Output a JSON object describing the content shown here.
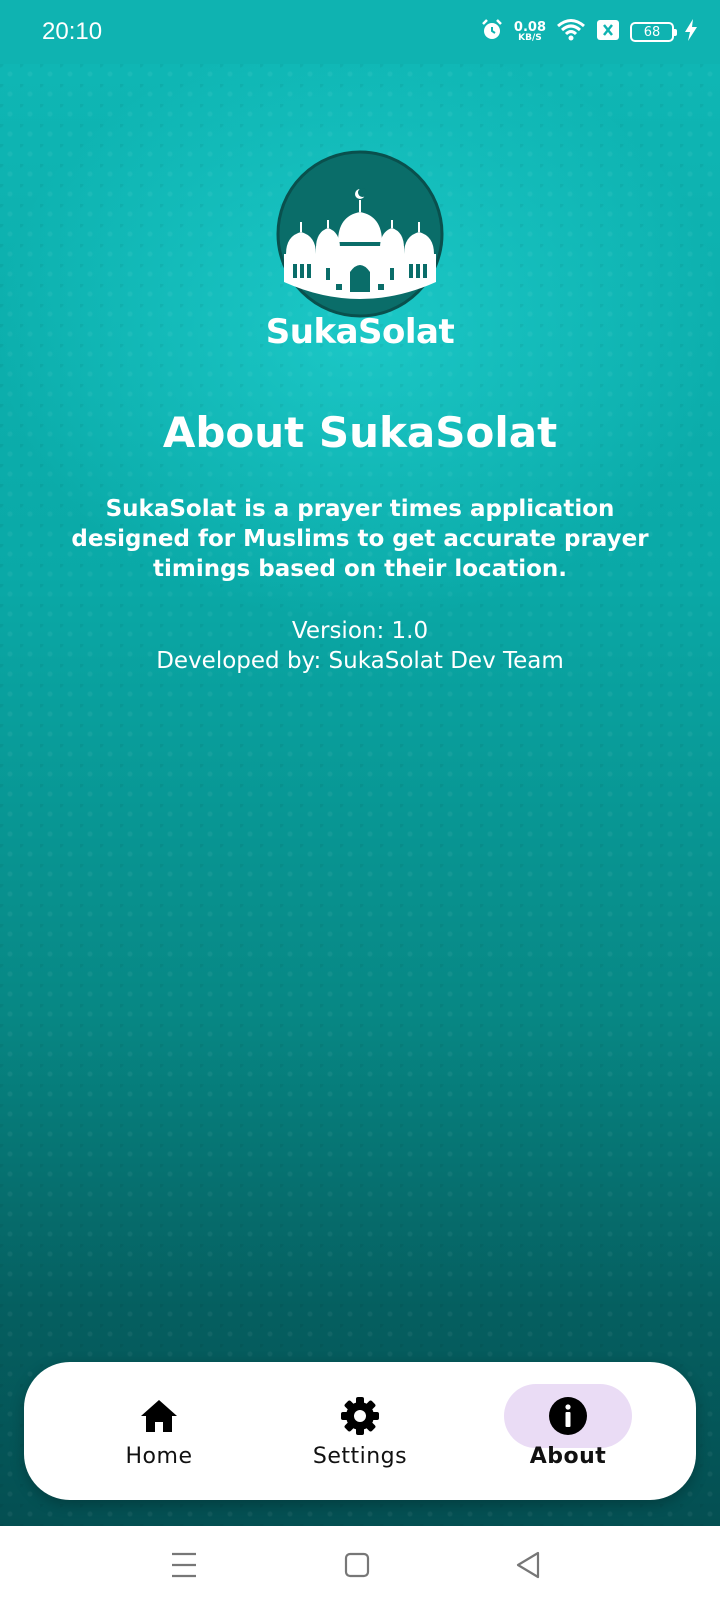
{
  "status_bar": {
    "time": "20:10",
    "net_speed_value": "0.08",
    "net_speed_unit": "KB/S",
    "battery": "68",
    "icons": [
      "alarm-icon",
      "wifi-icon",
      "sim-blocked-icon",
      "battery-icon",
      "charging-icon"
    ]
  },
  "app": {
    "logo_text": "SukaSolat",
    "logo_icon": "mosque-icon",
    "accent_color": "#0fb3b1"
  },
  "about": {
    "title": "About SukaSolat",
    "description": "SukaSolat is a prayer times application designed for Muslims to get accurate prayer timings based on their location.",
    "version": "Version: 1.0",
    "developer": "Developed by: SukaSolat Dev Team"
  },
  "bottom_nav": {
    "items": [
      {
        "label": "Home",
        "icon": "home-icon",
        "active": false
      },
      {
        "label": "Settings",
        "icon": "gear-icon",
        "active": false
      },
      {
        "label": "About",
        "icon": "info-icon",
        "active": true
      }
    ],
    "active_pill_color": "#eadcf5"
  },
  "system_nav": {
    "buttons": [
      "menu-icon",
      "home-square-icon",
      "back-triangle-icon"
    ]
  }
}
